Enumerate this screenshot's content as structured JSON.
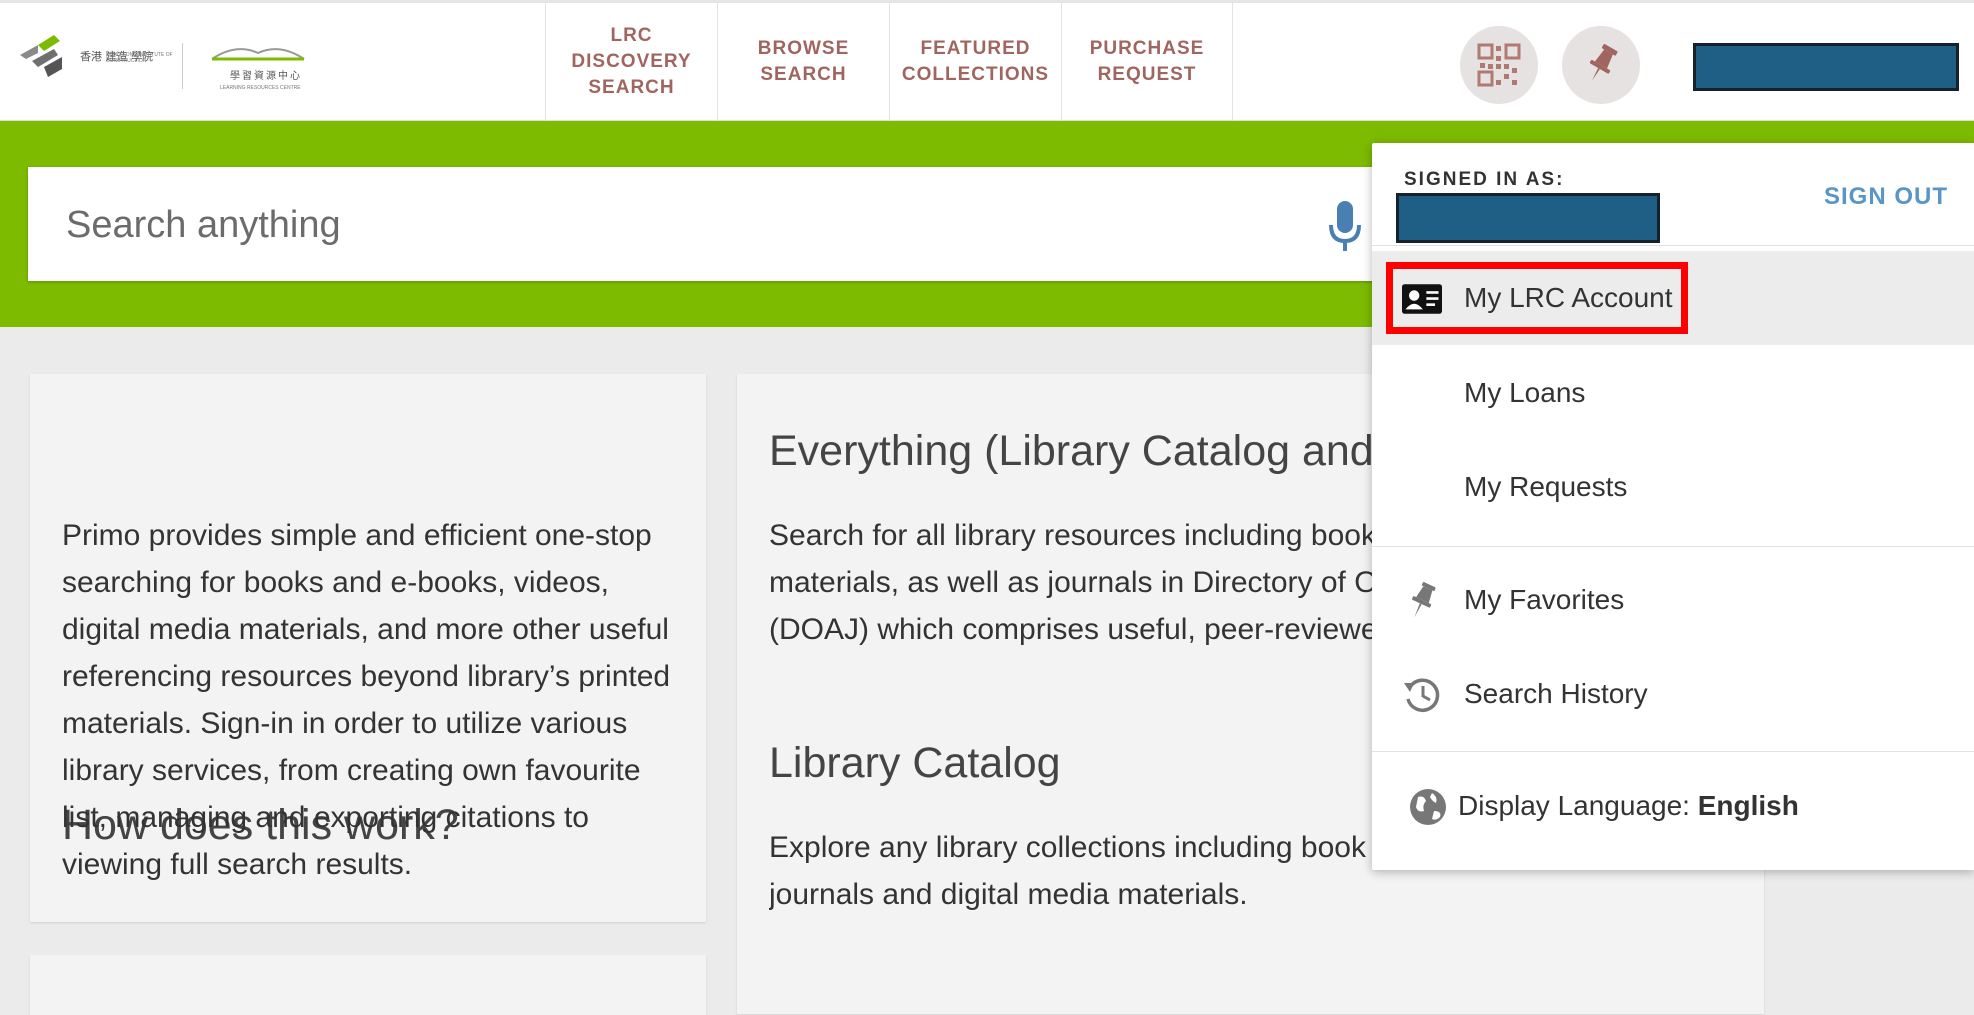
{
  "header": {
    "logo": {
      "institute_cn": "香港 建造 學院",
      "institute_en": "HONG KONG INSTITUTE OF CONSTRUCTION",
      "lrc_cn": "學習資源中心",
      "lrc_en": "LEARNING RESOURCES CENTRE"
    },
    "nav": [
      {
        "label": "LRC DISCOVERY SEARCH"
      },
      {
        "label": "BROWSE SEARCH"
      },
      {
        "label": "FEATURED COLLECTIONS"
      },
      {
        "label": "PURCHASE REQUEST"
      }
    ],
    "icons": {
      "qr": "qr-code-icon",
      "pin": "pin-icon"
    }
  },
  "search": {
    "placeholder": "Search anything",
    "value": "",
    "mic_icon": "microphone-icon"
  },
  "cards": {
    "how": {
      "title": "How does this work?",
      "text": "Primo provides simple and efficient one-stop searching for books and e-books, videos, digital media materials, and more other useful referencing resources beyond library’s printed materials. Sign-in in order to utilize various library services, from creating own favourite list, managing and exporting citations to viewing full search results."
    },
    "everything": {
      "title": "Everything (Library Catalog and",
      "lines": [
        "Search for all library resources including book",
        "materials, as well as journals in Directory of O",
        "(DOAJ) which comprises useful, peer-reviewe"
      ]
    },
    "catalog": {
      "title": "Library Catalog",
      "lines": [
        "Explore any library collections including book",
        "journals and digital media materials."
      ]
    }
  },
  "menu": {
    "signed_in_label": "SIGNED IN AS:",
    "sign_out": "SIGN OUT",
    "items": [
      {
        "label": "My LRC Account",
        "icon": "id-card-icon"
      },
      {
        "label": "My Loans"
      },
      {
        "label": "My Requests"
      },
      {
        "label": "My Favorites",
        "icon": "pin-icon"
      },
      {
        "label": "Search History",
        "icon": "history-icon"
      }
    ],
    "language": {
      "label": "Display Language:",
      "value": "English",
      "icon": "globe-icon"
    }
  },
  "colors": {
    "accent_green": "#7dbb00",
    "nav_text": "#a0655f",
    "sign_out": "#5a95c8",
    "redaction": "#1f5f86",
    "highlight": "#ff0000"
  }
}
